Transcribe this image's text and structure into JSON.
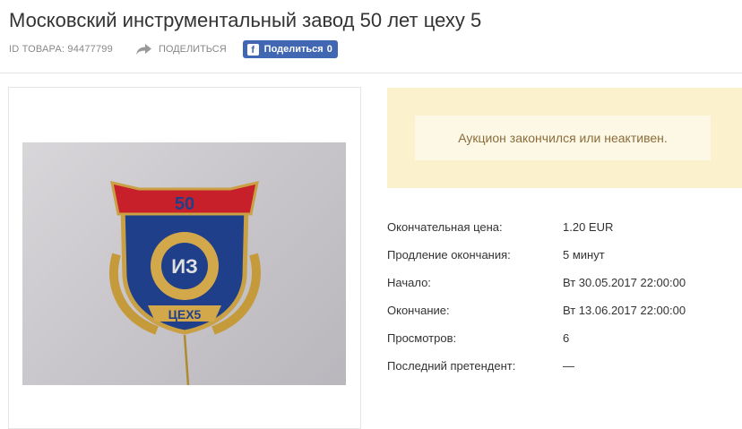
{
  "title": "Московский инструментальный завод 50 лет цеху 5",
  "meta": {
    "id_text": "ID ТОВАРА: 94477799",
    "share_label": "ПОДЕЛИТЬСЯ",
    "fb_label": "Поделиться",
    "fb_count": "0",
    "share_icon": "share-arrow-icon",
    "fb_icon": "facebook-icon"
  },
  "image": {
    "description_badge_number": "50",
    "badge_letters": "ИЗ",
    "badge_bottom_text": "ЦЕХ5"
  },
  "notice": {
    "text": "Аукцион закончился или неактивен."
  },
  "details": [
    {
      "label": "Окончательная цена:",
      "value": "1.20 EUR"
    },
    {
      "label": "Продление окончания:",
      "value": "5 минут"
    },
    {
      "label": "Начало:",
      "value": "Вт 30.05.2017 22:00:00"
    },
    {
      "label": "Окончание:",
      "value": "Вт 13.06.2017 22:00:00"
    },
    {
      "label": "Просмотров:",
      "value": "6"
    },
    {
      "label": "Последний претендент:",
      "value": "—"
    }
  ],
  "colors": {
    "notice_bg": "#fcf1cd",
    "notice_text": "#8a6d3b",
    "facebook": "#4267b2"
  }
}
